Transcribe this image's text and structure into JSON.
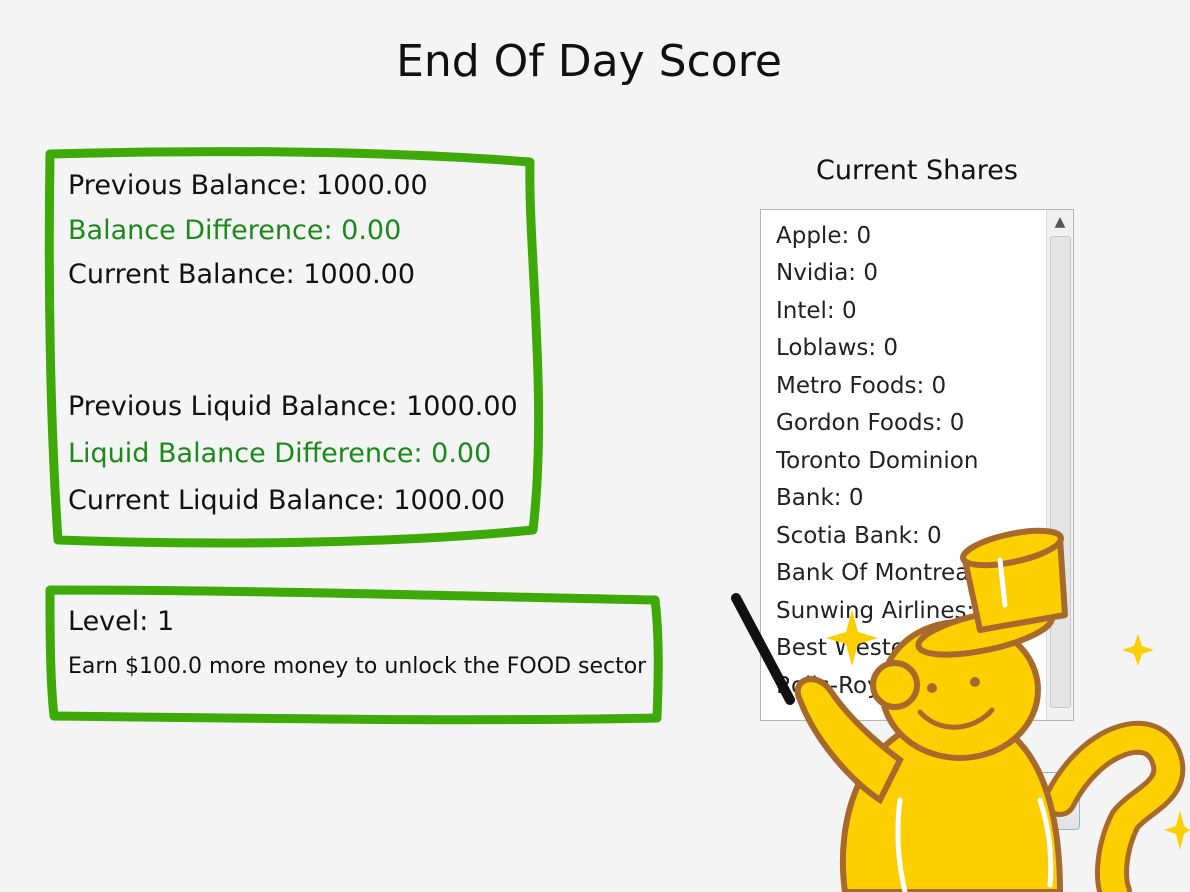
{
  "window": {
    "title": "End Of Day Score"
  },
  "balances": {
    "previous_balance": "Previous Balance: 1000.00",
    "balance_difference": "Balance Difference: 0.00",
    "current_balance": "Current Balance: 1000.00",
    "previous_liquid": "Previous Liquid Balance: 1000.00",
    "liquid_difference": "Liquid Balance Difference: 0.00",
    "current_liquid": "Current Liquid Balance: 1000.00"
  },
  "level": {
    "label": "Level: 1",
    "unlock_text": "Earn $100.0 more money to unlock the FOOD sector"
  },
  "shares": {
    "title": "Current Shares",
    "items": [
      "Apple: 0",
      "Nvidia: 0",
      "Intel: 0",
      "Loblaws: 0",
      "Metro Foods: 0",
      "Gordon Foods: 0",
      "Toronto Dominion",
      "Bank: 0",
      "Scotia Bank: 0",
      "Bank Of Montreal: 0",
      "Sunwing Airlines: 0",
      "Best Western: 0",
      "Rolls-Royce: 0"
    ]
  },
  "icons": {
    "mascot": "monkey-magician-icon",
    "scroll_up": "chevron-up-icon"
  },
  "colors": {
    "highlight": "#3daa0a",
    "difference_text": "#1a8a1a",
    "mascot_fill": "#fcd000",
    "mascot_outline": "#a86a2c"
  }
}
